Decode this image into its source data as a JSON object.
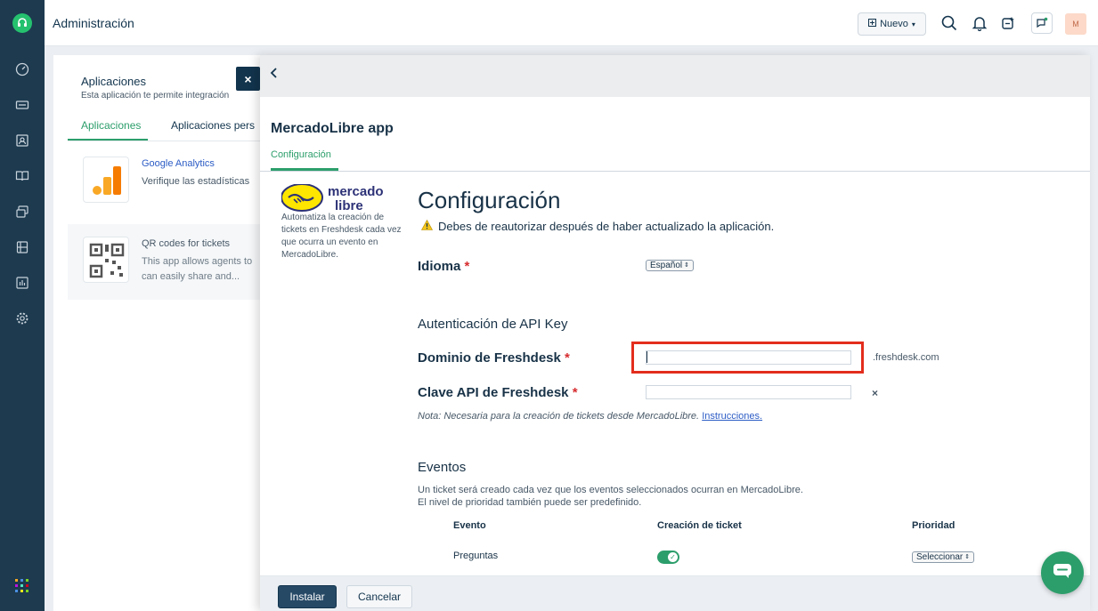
{
  "header": {
    "title": "Administración",
    "new_button_label": "Nuevo",
    "avatar_initial": "M"
  },
  "background_page": {
    "title": "Aplicaciones",
    "subtitle": "Esta aplicación te permite integración",
    "tabs": [
      {
        "label": "Aplicaciones",
        "active": true
      },
      {
        "label": "Aplicaciones pers",
        "active": false
      }
    ],
    "apps": [
      {
        "name": "Google Analytics",
        "description": "Verifique las estadísticas"
      },
      {
        "name": "QR codes for tickets",
        "description": "This app allows agents to can easily share and..."
      }
    ]
  },
  "modal": {
    "app_title": "MercadoLibre app",
    "tab_label": "Configuración",
    "logo_text_top": "mercado",
    "logo_text_bottom": "libre",
    "app_description": "Automatiza la creación de tickets en Freshdesk cada vez que ocurra un evento en MercadoLibre.",
    "heading": "Configuración",
    "warning": "Debes de reautorizar después de haber actualizado la aplicación.",
    "language": {
      "label": "Idioma",
      "value": "Español"
    },
    "api_section_title": "Autenticación de API Key",
    "domain": {
      "label": "Dominio de Freshdesk",
      "value": "",
      "suffix": ".freshdesk.com"
    },
    "api_key": {
      "label": "Clave API de Freshdesk",
      "value": ""
    },
    "required_mark": "*",
    "note_text": "Nota: Necesaria para la creación de tickets desde MercadoLibre.",
    "note_link": "Instrucciones.",
    "events": {
      "title": "Eventos",
      "description_line1": "Un ticket será creado cada vez que los eventos seleccionados ocurran en MercadoLibre.",
      "description_line2": "El nivel de prioridad también puede ser predefinido.",
      "columns": [
        "Evento",
        "Creación de ticket",
        "Prioridad"
      ],
      "rows": [
        {
          "event": "Preguntas",
          "create_ticket": true,
          "priority": "Seleccionar"
        }
      ]
    },
    "install_button": "Instalar",
    "cancel_button": "Cancelar"
  },
  "colors": {
    "sidebar": "#1d3a4f",
    "accent_green": "#2c9e6b",
    "primary_button": "#264966",
    "highlight_red": "#e32d1d"
  }
}
